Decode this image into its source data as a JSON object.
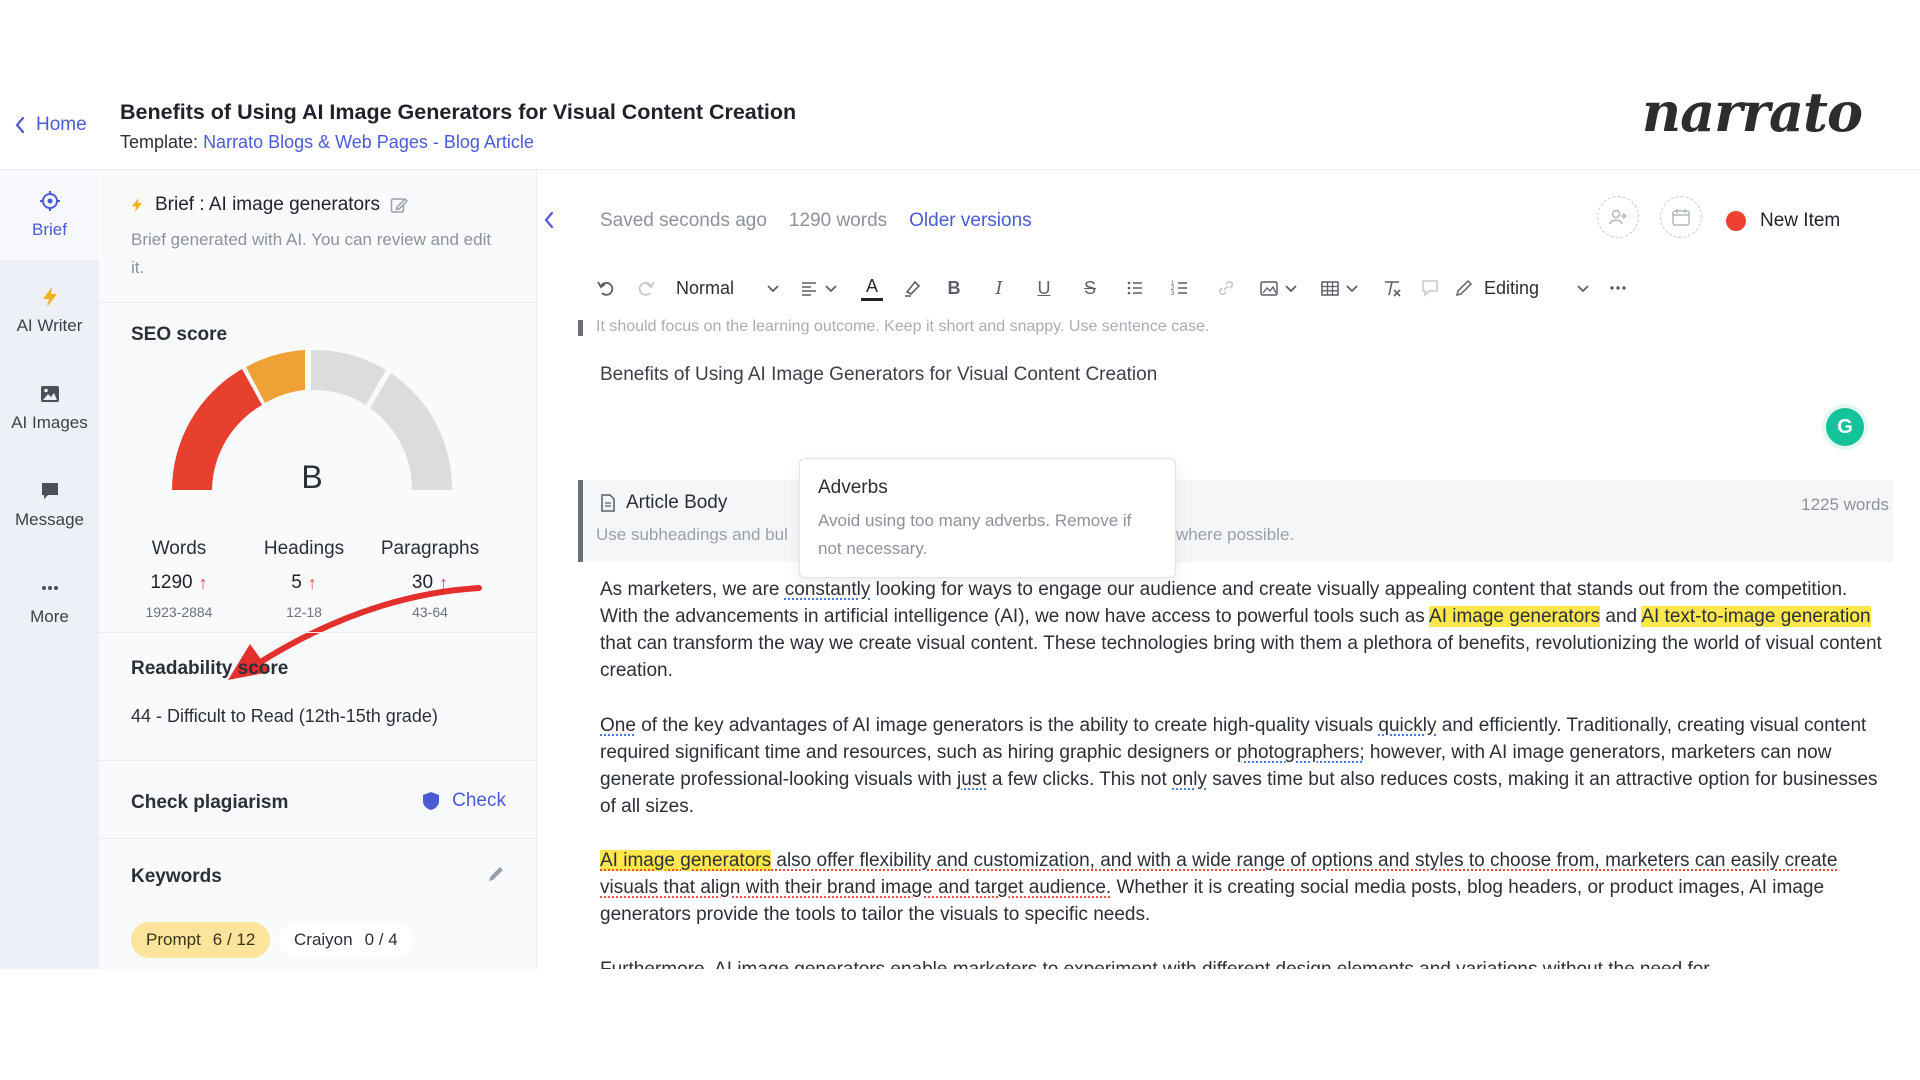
{
  "header": {
    "home_label": "Home",
    "title": "Benefits of Using AI Image Generators for Visual Content Creation",
    "template_prefix": "Template:",
    "template_link": "Narrato Blogs & Web Pages - Blog Article",
    "logo": "narrato"
  },
  "rail": {
    "items": [
      {
        "label": "Brief",
        "icon": "target-icon",
        "active": true
      },
      {
        "label": "AI Writer",
        "icon": "lightning-icon"
      },
      {
        "label": "AI Images",
        "icon": "image-icon"
      },
      {
        "label": "Message",
        "icon": "chat-icon"
      },
      {
        "label": "More",
        "icon": "more-dots-icon"
      }
    ]
  },
  "brief": {
    "title": "Brief : AI image generators",
    "description": "Brief generated with AI. You can review and edit it.",
    "seo_title": "SEO score",
    "seo_grade": "B",
    "seo_level": 0.6,
    "stats": [
      {
        "label": "Words",
        "value": "1290",
        "range": "1923-2884"
      },
      {
        "label": "Headings",
        "value": "5",
        "range": "12-18"
      },
      {
        "label": "Paragraphs",
        "value": "30",
        "range": "43-64"
      }
    ],
    "readability_title": "Readability score",
    "readability_value": "44 - Difficult to Read (12th-15th grade)",
    "plagiarism_title": "Check plagiarism",
    "plagiarism_button": "Check",
    "keywords_title": "Keywords",
    "keyword_chips": [
      {
        "label": "Prompt",
        "count": "6 / 12"
      },
      {
        "label": "Craiyon",
        "count": "0 / 4"
      }
    ],
    "colors": {
      "gauge_red": "#e8402f",
      "gauge_orange": "#f0a136",
      "gauge_gray": "#dcdcdc",
      "accent": "#4a5bd6"
    }
  },
  "editor": {
    "saved": "Saved seconds ago",
    "words": "1290 words",
    "older_versions": "Older versions",
    "new_item": "New Item",
    "toolbar": {
      "style": "Normal",
      "mode": "Editing"
    },
    "faint_line": "It should focus on the learning outcome. Keep it short and snappy. Use sentence case.",
    "heading": "Benefits of Using AI Image Generators for Visual Content Creation",
    "body_title": "Article Body",
    "body_desc_a": "Use subheadings and bul",
    "body_desc_b": "where possible.",
    "body_words": "1225 words",
    "tooltip": {
      "title": "Adverbs",
      "body": "Avoid using too many adverbs. Remove if not necessary."
    },
    "p1": {
      "a": "As marketers, we are ",
      "b": "constantly",
      "c": " looking for ways to engage our audience and create visually appealing content that stands out from the competition. With the advancements in artificial intelligence (AI), we now have access to powerful tools such as ",
      "d": "AI image generators",
      "e": " and ",
      "f": "AI text-to-image generation",
      "g": " that can transform the way we create visual content. These technologies bring with them a plethora of benefits, revolutionizing the world of visual content creation."
    },
    "p2": {
      "a": "One",
      "b": " of the key advantages of AI image generators is the ability to create high-quality visuals ",
      "c": "quickly",
      "d": " and efficiently. Traditionally, creating visual content required significant time and resources, such as hiring graphic designers or ",
      "e": "photographers;",
      "f": " however, with AI image generators, marketers can now generate professional-looking visuals with ",
      "g": "just",
      "h": " a few clicks. This not ",
      "i": "only",
      "j": " saves time but also reduces costs, making it an attractive option for businesses of all sizes."
    },
    "p3": {
      "a": "AI image generators",
      "b": " also offer flexibility and customization, and with a wide range of options and styles to choose from, marketers can easily create visuals that align with their brand image and target audience.",
      "c": " Whether it is creating social media posts, blog headers, or product images, AI image generators provide the tools to tailor the visuals to specific needs."
    },
    "p4": "Furthermore, AI image generators enable marketers to experiment with different design elements and variations without the need for"
  }
}
